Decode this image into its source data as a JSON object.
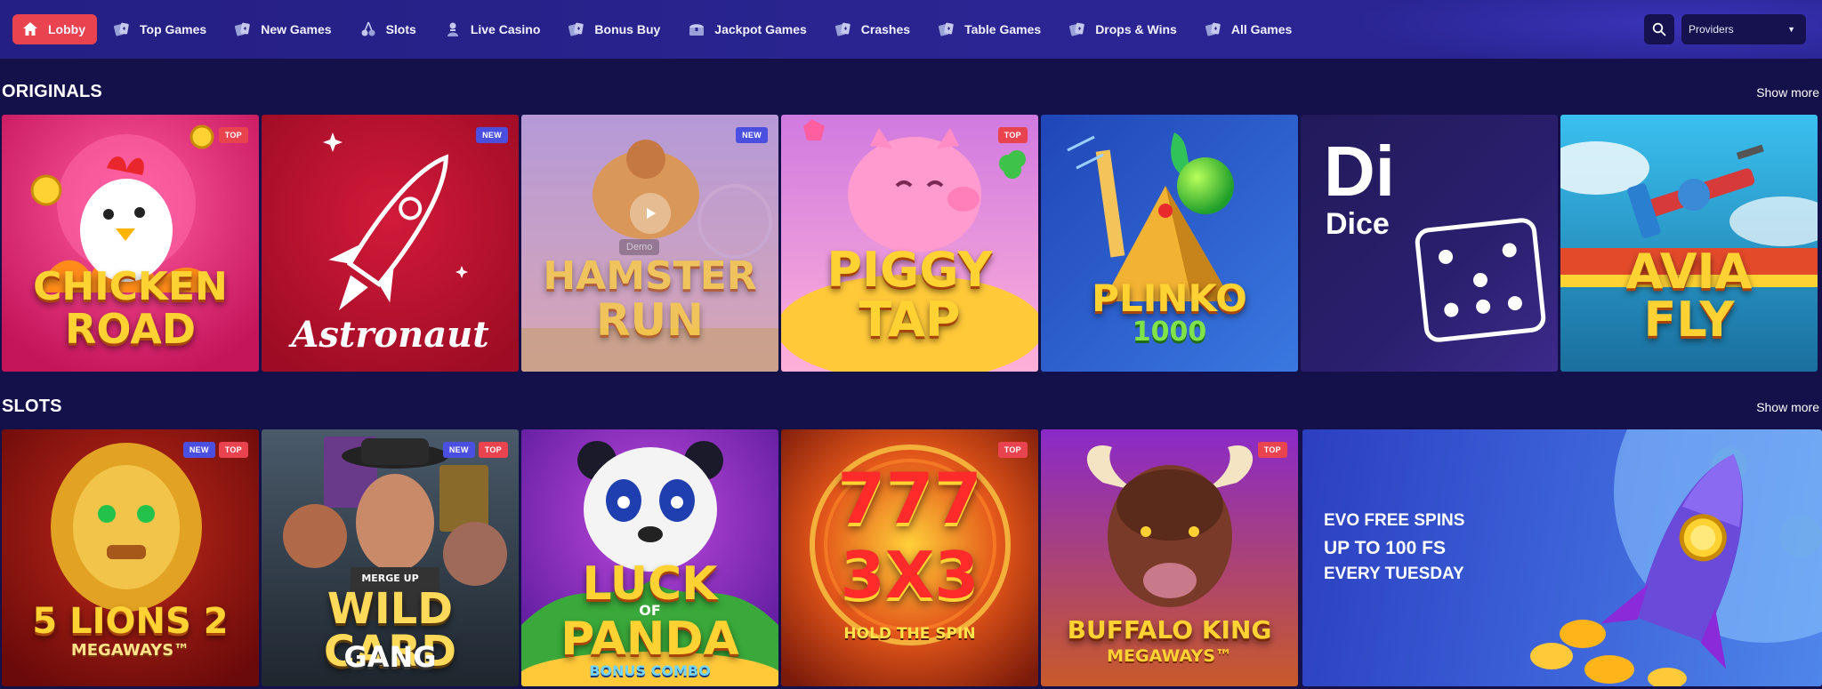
{
  "nav": {
    "items": [
      {
        "label": "Lobby",
        "icon": "home-icon",
        "active": true
      },
      {
        "label": "Top Games",
        "icon": "cards-icon"
      },
      {
        "label": "New Games",
        "icon": "cards-icon"
      },
      {
        "label": "Slots",
        "icon": "cherry-icon"
      },
      {
        "label": "Live Casino",
        "icon": "dealer-icon"
      },
      {
        "label": "Bonus Buy",
        "icon": "cards-icon"
      },
      {
        "label": "Jackpot Games",
        "icon": "chest-icon"
      },
      {
        "label": "Crashes",
        "icon": "cards-icon"
      },
      {
        "label": "Table Games",
        "icon": "cards-icon"
      },
      {
        "label": "Drops & Wins",
        "icon": "cards-icon"
      },
      {
        "label": "All Games",
        "icon": "cards-icon"
      }
    ],
    "search_icon": "search-icon",
    "providers_label": "Providers"
  },
  "originals": {
    "title": "ORIGINALS",
    "show_more": "Show more",
    "games": [
      {
        "name": "CHICKEN",
        "name2": "ROAD",
        "badges": [
          "TOP"
        ]
      },
      {
        "name": "Astronaut",
        "badges": [
          "NEW"
        ]
      },
      {
        "name": "HAMSTER",
        "name2": "RUN",
        "badges": [
          "NEW"
        ],
        "demo": "Demo"
      },
      {
        "name": "PIGGY",
        "name2": "TAP",
        "badges": [
          "TOP"
        ]
      },
      {
        "name": "PLINKO",
        "name2": "1000",
        "badges": []
      },
      {
        "name": "Di",
        "name2": "Dice",
        "badges": []
      },
      {
        "name": "AVIA",
        "name2": "FLY",
        "badges": []
      }
    ]
  },
  "slots": {
    "title": "SLOTS",
    "show_more": "Show more",
    "games": [
      {
        "name": "5 LIONS 2",
        "name2": "MEGAWAYS™",
        "badges": [
          "NEW",
          "TOP"
        ]
      },
      {
        "name": "WILD CARD",
        "name2": "GANG",
        "tag": "MERGE UP",
        "badges": [
          "NEW",
          "TOP"
        ]
      },
      {
        "name": "LUCK",
        "mid": "OF",
        "name2": "PANDA",
        "name3": "BONUS COMBO",
        "badges": []
      },
      {
        "name": "777",
        "name2": "3X3",
        "name3": "HOLD THE SPIN",
        "badges": [
          "TOP"
        ]
      },
      {
        "name": "BUFFALO KING",
        "name2": "MEGAWAYS™",
        "badges": [
          "TOP"
        ]
      }
    ],
    "promo": {
      "line1": "EVO FREE SPINS",
      "line2": "UP TO 100 FS",
      "line3": "EVERY TUESDAY"
    }
  },
  "colors": {
    "background": "#13104a",
    "nav": "#2a2592",
    "active": "#e8434f",
    "badge_new": "#4b4fe0",
    "badge_top": "#e8434f"
  }
}
